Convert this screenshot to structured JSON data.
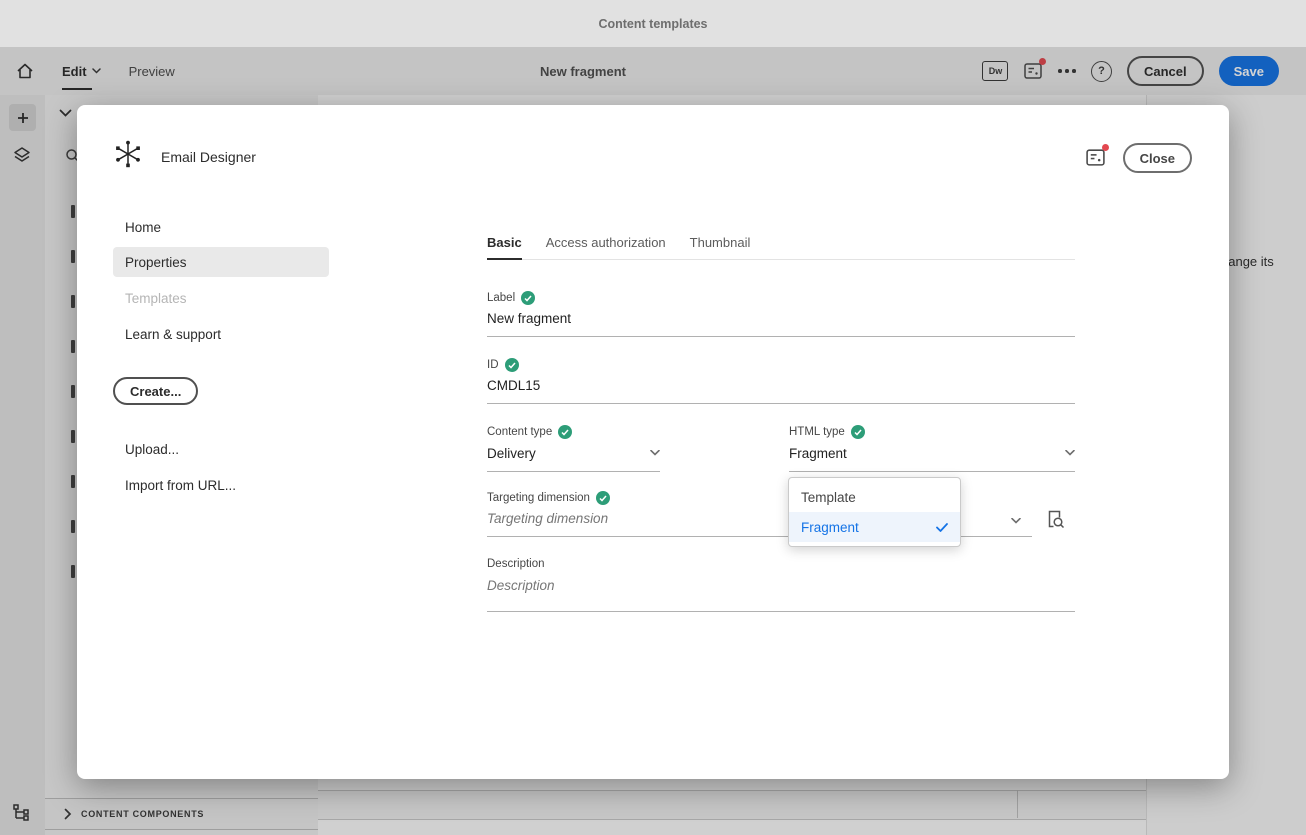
{
  "colors": {
    "accent": "#1473e6",
    "positive": "#2d9d78",
    "notification": "#e34850"
  },
  "os_bar": {
    "title": "Content templates"
  },
  "toolbar": {
    "edit_label": "Edit",
    "preview_label": "Preview",
    "doc_title": "New fragment",
    "dw_label": "Dw",
    "help_label": "?",
    "cancel_label": "Cancel",
    "save_label": "Save"
  },
  "side_panel": {
    "footer_label": "CONTENT COMPONENTS"
  },
  "canvas": {
    "clipped_text": "hange its"
  },
  "modal": {
    "app_name": "Email Designer",
    "close_label": "Close",
    "nav": {
      "home": "Home",
      "properties": "Properties",
      "templates": "Templates",
      "learn": "Learn & support",
      "create_label": "Create...",
      "upload_label": "Upload...",
      "import_label": "Import from URL..."
    },
    "tabs": {
      "basic": "Basic",
      "access": "Access authorization",
      "thumbnail": "Thumbnail"
    },
    "form": {
      "label_field": {
        "label": "Label",
        "value": "New fragment"
      },
      "id_field": {
        "label": "ID",
        "value": "CMDL15"
      },
      "content_type": {
        "label": "Content type",
        "value": "Delivery"
      },
      "html_type": {
        "label": "HTML type",
        "value": "Fragment"
      },
      "targeting": {
        "label": "Targeting dimension",
        "placeholder": "Targeting dimension"
      },
      "description": {
        "label": "Description",
        "placeholder": "Description"
      }
    },
    "dropdown": {
      "template_option": "Template",
      "fragment_option": "Fragment"
    }
  }
}
